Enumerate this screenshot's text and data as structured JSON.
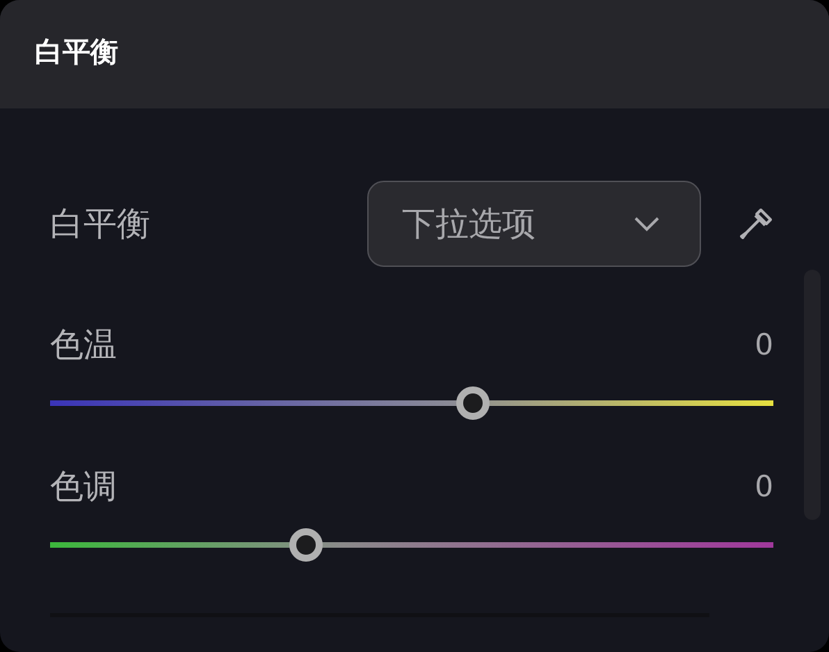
{
  "panel": {
    "title": "白平衡"
  },
  "white_balance": {
    "label": "白平衡",
    "dropdown": {
      "value": "下拉选项"
    }
  },
  "sliders": [
    {
      "kind": "temperature",
      "label": "色温",
      "reading": "0",
      "level": 0.585
    },
    {
      "kind": "tint",
      "label": "色调",
      "reading": "0",
      "level": 0.354
    }
  ]
}
